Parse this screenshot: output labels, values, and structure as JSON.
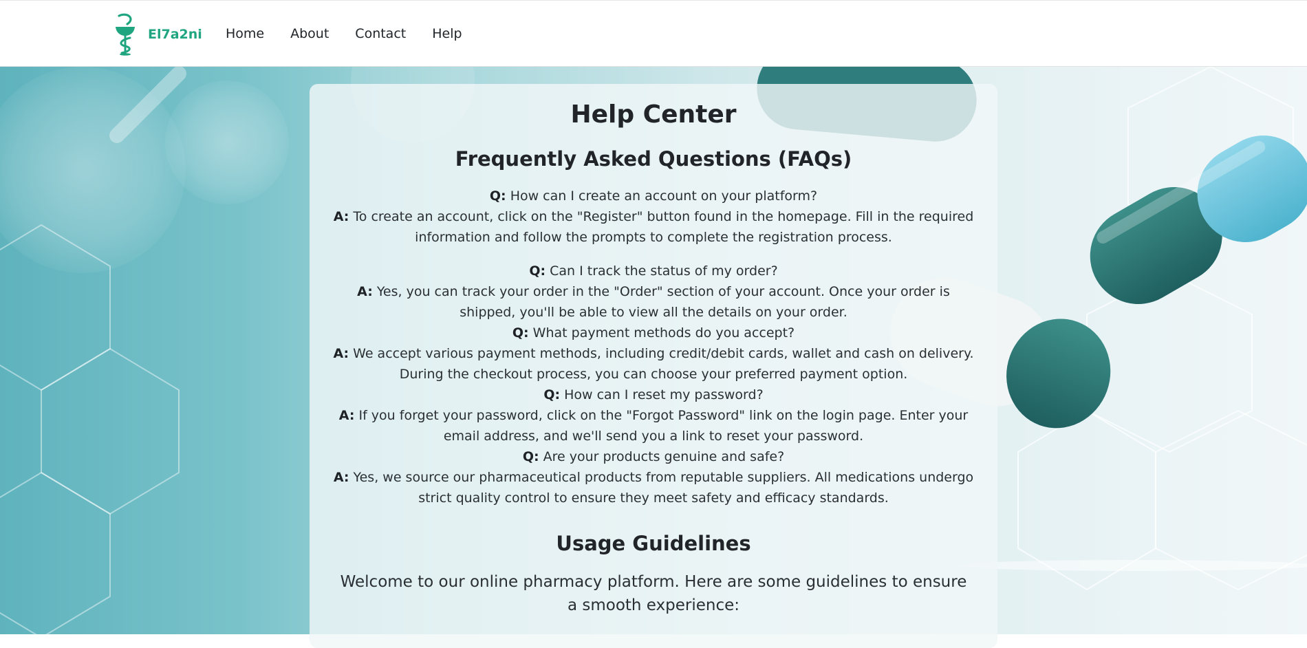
{
  "brand": {
    "name": "El7a2ni",
    "logo_icon": "caduceus-bowl-icon",
    "accent": "#1fa57f"
  },
  "nav": {
    "items": [
      {
        "label": "Home"
      },
      {
        "label": "About"
      },
      {
        "label": "Contact"
      },
      {
        "label": "Help"
      }
    ]
  },
  "help": {
    "title": "Help Center",
    "faq_title": "Frequently Asked Questions (FAQs)",
    "q_label": "Q:",
    "a_label": "A:",
    "faqs": [
      {
        "q": "How can I create an account on your platform?",
        "a": "To create an account, click on the \"Register\" button found in the homepage. Fill in the required information and follow the prompts to complete the registration process."
      },
      {
        "q": "Can I track the status of my order?",
        "a": "Yes, you can track your order in the \"Order\" section of your account. Once your order is shipped, you'll be able to view all the details on your order."
      },
      {
        "q": "What payment methods do you accept?",
        "a": "We accept various payment methods, including credit/debit cards, wallet and cash on delivery. During the checkout process, you can choose your preferred payment option."
      },
      {
        "q": "How can I reset my password?",
        "a": "If you forget your password, click on the \"Forgot Password\" link on the login page. Enter your email address, and we'll send you a link to reset your password."
      },
      {
        "q": "Are your products genuine and safe?",
        "a": "Yes, we source our pharmaceutical products from reputable suppliers. All medications undergo strict quality control to ensure they meet safety and efficacy standards."
      }
    ],
    "usage_title": "Usage Guidelines",
    "usage_intro": "Welcome to our online pharmacy platform. Here are some guidelines to ensure a smooth experience:"
  }
}
